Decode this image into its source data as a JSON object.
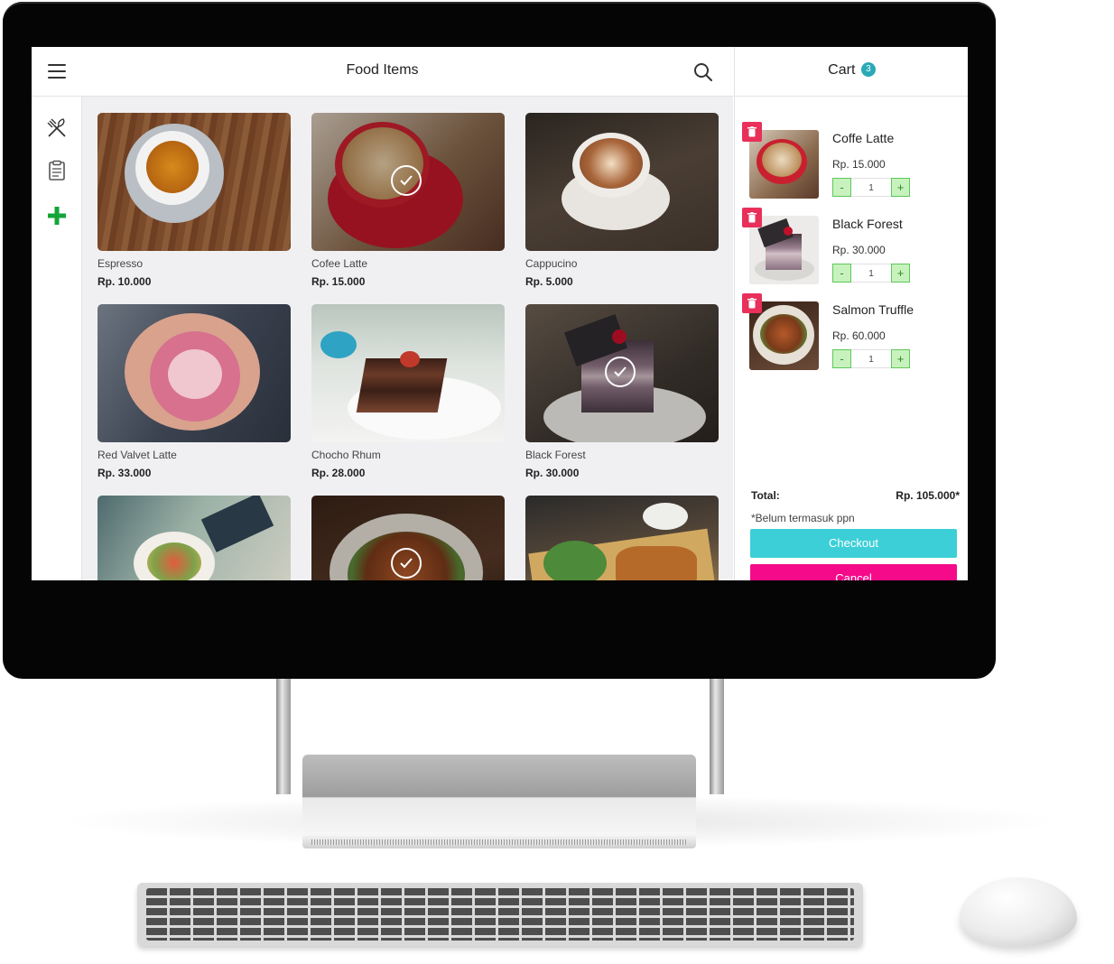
{
  "app": {
    "title": "Food Items",
    "menu_icon": "hamburger-menu-icon",
    "search_icon": "search-icon"
  },
  "sidebar": {
    "items": [
      {
        "icon": "utensils-icon"
      },
      {
        "icon": "clipboard-icon"
      },
      {
        "icon": "plus-icon",
        "color": "#13a538"
      }
    ]
  },
  "products": [
    {
      "name": "Espresso",
      "price": "Rp. 10.000",
      "selected": false
    },
    {
      "name": "Cofee Latte",
      "price": "Rp. 15.000",
      "selected": true
    },
    {
      "name": "Cappucino",
      "price": "Rp. 5.000",
      "selected": false
    },
    {
      "name": "Red Valvet Latte",
      "price": "Rp. 33.000",
      "selected": false
    },
    {
      "name": "Chocho Rhum",
      "price": "Rp. 28.000",
      "selected": false
    },
    {
      "name": "Black Forest",
      "price": "Rp. 30.000",
      "selected": true
    },
    {
      "selected": false
    },
    {
      "selected": true
    },
    {
      "selected": false
    }
  ],
  "cart": {
    "title": "Cart",
    "count": "3",
    "items": [
      {
        "name": "Coffe Latte",
        "price": "Rp. 15.000",
        "qty": "1",
        "minus": "-",
        "plus": "+"
      },
      {
        "name": "Black Forest",
        "price": "Rp. 30.000",
        "qty": "1",
        "minus": "-",
        "plus": "+"
      },
      {
        "name": "Salmon Truffle",
        "price": "Rp. 60.000",
        "qty": "1",
        "minus": "-",
        "plus": "+"
      }
    ],
    "total_label": "Total:",
    "total_value": "Rp. 105.000*",
    "tax_note": "*Belum termasuk ppn",
    "checkout_label": "Checkout",
    "cancel_label": "Cancel"
  },
  "colors": {
    "accent": "#3ccfd7",
    "cancel": "#f50b8a",
    "badge": "#2aa9b8",
    "delete": "#e8305a",
    "stepper": "#c8f2bd"
  }
}
